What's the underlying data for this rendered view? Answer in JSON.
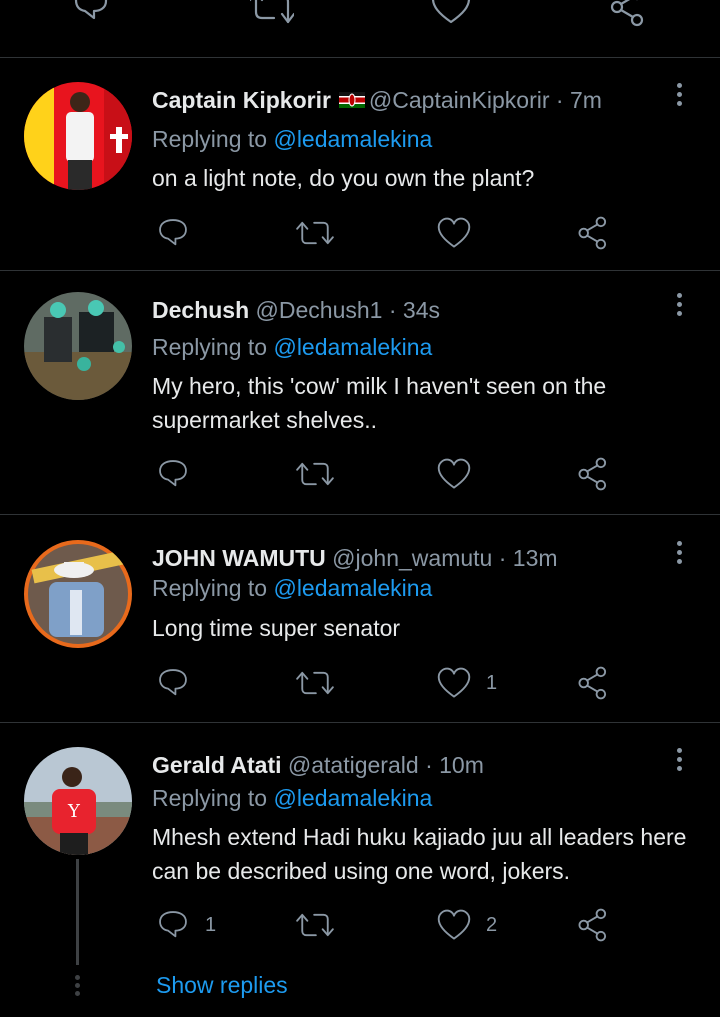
{
  "tweets": [
    {
      "name": "Captain Kipkorir",
      "has_flag": true,
      "handle": "@CaptainKipkorir",
      "time": "7m",
      "replying_prefix": "Replying to",
      "replying_mention": "@ledamalekina",
      "text": "on a light note, do you own the plant?",
      "likes": "",
      "replies": ""
    },
    {
      "name": "Dechush",
      "handle": "@Dechush1",
      "time": "34s",
      "replying_prefix": "Replying to",
      "replying_mention": "@ledamalekina",
      "text": "My hero, this 'cow' milk I haven't seen on the supermarket shelves..",
      "likes": "",
      "replies": ""
    },
    {
      "name": "JOHN WAMUTU",
      "handle": "@john_wamutu",
      "time": "13m",
      "replying_prefix": "Replying to",
      "replying_mention": "@ledamalekina",
      "text": "Long time super senator",
      "likes": "1",
      "replies": ""
    },
    {
      "name": "Gerald Atati",
      "handle": "@atatigerald",
      "time": "10m",
      "replying_prefix": "Replying to",
      "replying_mention": "@ledamalekina",
      "text": "Mhesh extend Hadi huku kajiado juu all leaders here can be described using one word, jokers.",
      "likes": "2",
      "replies": "1"
    }
  ],
  "show_replies": "Show replies",
  "separator": "·",
  "icons": {
    "reply": "reply-icon",
    "retweet": "retweet-icon",
    "like": "heart-icon",
    "share": "share-icon",
    "more": "more-icon"
  },
  "colors": {
    "background": "#000000",
    "text": "#e7e9ea",
    "muted": "#8b98a5",
    "link": "#1d9bf0",
    "divider": "#2f3336"
  }
}
